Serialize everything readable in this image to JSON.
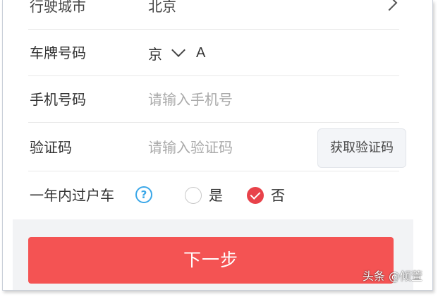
{
  "form": {
    "city": {
      "label": "行驶城市",
      "value": "北京"
    },
    "plate": {
      "label": "车牌号码",
      "province": "京",
      "letter": "A"
    },
    "phone": {
      "label": "手机号码",
      "placeholder": "请输入手机号"
    },
    "code": {
      "label": "验证码",
      "placeholder": "请输入验证码",
      "button": "获取验证码"
    },
    "transfer": {
      "label": "一年内过户车",
      "help_icon": "question-circle-icon",
      "options": [
        {
          "label": "是",
          "selected": false
        },
        {
          "label": "否",
          "selected": true
        }
      ]
    }
  },
  "footer": {
    "next_label": "下一步"
  },
  "watermark": "头条 @倾萱",
  "colors": {
    "accent": "#f45353",
    "selected_radio": "#e8424a",
    "help_icon": "#3aa7e8",
    "footer_bg": "#f2f3f5"
  }
}
